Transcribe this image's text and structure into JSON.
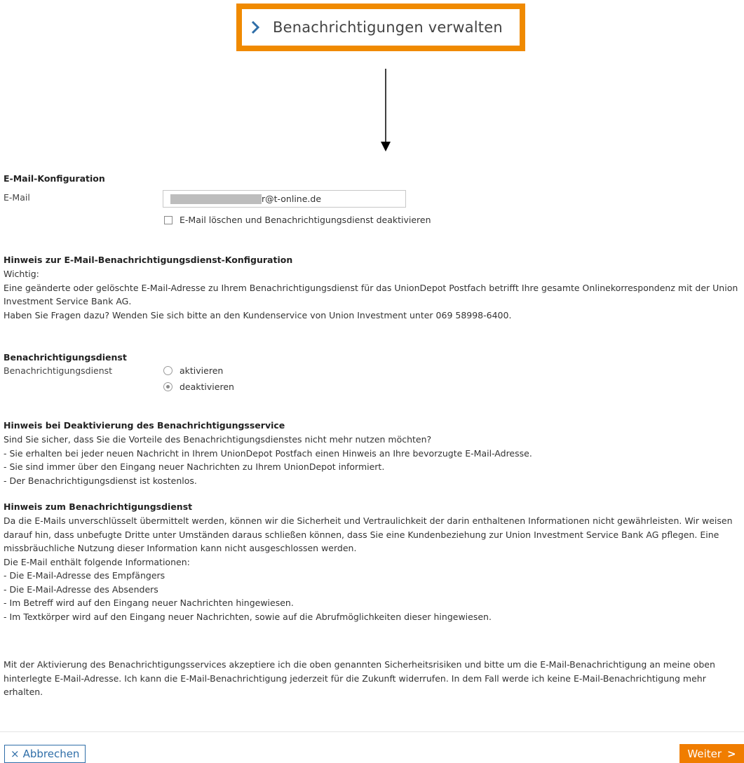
{
  "callout": {
    "title": "Benachrichtigungen verwalten"
  },
  "email_section": {
    "title": "E-Mail-Konfiguration",
    "email_label": "E-Mail",
    "email_value": "r@t-online.de",
    "delete_checkbox_label": "E-Mail löschen und Benachrichtigungsdienst deaktivieren",
    "delete_checked": false
  },
  "hint_email": {
    "title": "Hinweis zur E-Mail-Benachrichtigungsdienst-Konfiguration",
    "lines": [
      "Wichtig:",
      "Eine geänderte oder gelöschte E-Mail-Adresse zu Ihrem Benachrichtigungsdienst für das UnionDepot Postfach betrifft Ihre gesamte Onlinekorrespondenz mit der Union Investment Service Bank AG.",
      "Haben Sie Fragen dazu? Wenden Sie sich bitte an den Kundenservice von Union Investment unter 069 58998-6400."
    ]
  },
  "notification": {
    "title": "Benachrichtigungsdienst",
    "label": "Benachrichtigungsdienst",
    "options": [
      "aktivieren",
      "deaktivieren"
    ],
    "selected": "deaktivieren"
  },
  "hint_deactivation": {
    "title": "Hinweis bei Deaktivierung des Benachrichtigungsservice",
    "lines": [
      "Sind Sie sicher, dass Sie die Vorteile des Benachrichtigungsdienstes nicht mehr nutzen möchten?",
      "- Sie erhalten bei jeder neuen Nachricht in Ihrem UnionDepot Postfach einen Hinweis an Ihre bevorzugte E-Mail-Adresse.",
      "- Sie sind immer über den Eingang neuer Nachrichten zu Ihrem UnionDepot informiert.",
      "- Der Benachrichtigungsdienst ist kostenlos."
    ]
  },
  "hint_service": {
    "title": "Hinweis zum Benachrichtigungsdienst",
    "paragraph": "Da die E-Mails unverschlüsselt übermittelt werden, können wir die Sicherheit und Vertraulichkeit der darin enthaltenen Informationen nicht gewährleisten. Wir weisen darauf hin, dass unbefugte Dritte unter Umständen daraus schließen können, dass Sie eine Kundenbeziehung zur Union Investment Service Bank AG pflegen. Eine missbräuchliche Nutzung dieser Information kann nicht ausgeschlossen werden.",
    "list_intro": "Die E-Mail enthält folgende Informationen:",
    "items": [
      "- Die E-Mail-Adresse des Empfängers",
      "- Die E-Mail-Adresse des Absenders",
      "- Im Betreff wird auf den Eingang neuer Nachrichten hingewiesen.",
      "- Im Textkörper wird auf den Eingang neuer Nachrichten, sowie auf die Abrufmöglichkeiten dieser hingewiesen."
    ],
    "consent": "Mit der Aktivierung des Benachrichtigungsservices akzeptiere ich die oben genannten Sicherheitsrisiken und bitte um die E-Mail-Benachrichtigung an meine oben hinterlegte E-Mail-Adresse. Ich kann die E-Mail-Benachrichtigung jederzeit für die Zukunft widerrufen. In dem Fall werde ich keine E-Mail-Benachrichtigung mehr erhalten."
  },
  "footer": {
    "cancel_label": "Abbrechen",
    "next_label": "Weiter"
  },
  "colors": {
    "accent": "#f07d00",
    "link": "#2f6ea8"
  }
}
